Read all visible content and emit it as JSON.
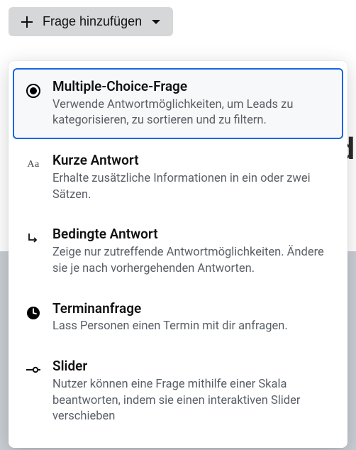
{
  "button": {
    "label": "Frage hinzufügen"
  },
  "bg_letter": "d",
  "menu": {
    "options": [
      {
        "title": "Multiple-Choice-Frage",
        "desc": "Verwende Antwortmöglichkeiten, um Leads zu kategorisieren, zu sortieren und zu filtern."
      },
      {
        "title": "Kurze Antwort",
        "desc": "Erhalte zusätzliche Informationen in ein oder zwei Sätzen."
      },
      {
        "title": "Bedingte Antwort",
        "desc": "Zeige nur zutreffende Antwortmöglichkeiten. Ändere sie je nach vorhergehenden Antworten."
      },
      {
        "title": "Terminanfrage",
        "desc": "Lass Personen einen Termin mit dir anfragen."
      },
      {
        "title": "Slider",
        "desc": "Nutzer können eine Frage mithilfe einer Skala beantworten, indem sie einen interaktiven Slider verschieben"
      }
    ]
  },
  "icons": {
    "aa": "Aa"
  }
}
